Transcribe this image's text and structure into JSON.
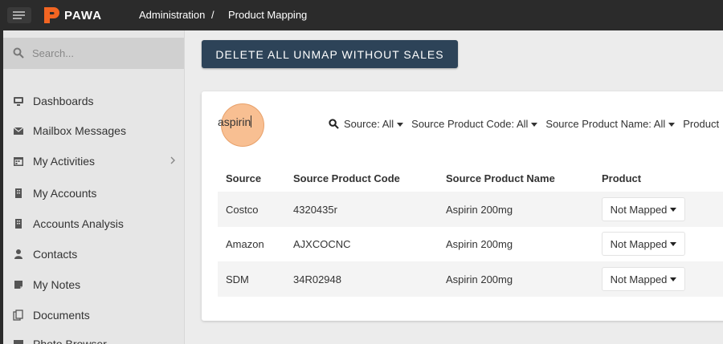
{
  "header": {
    "logo_text": "PAWA",
    "breadcrumb": [
      "Administration",
      "/",
      "Product Mapping"
    ],
    "brand_color": "#f26522"
  },
  "sidebar": {
    "search_placeholder": "Search...",
    "items": [
      {
        "label": "Dashboards",
        "icon": "monitor-icon"
      },
      {
        "label": "Mailbox Messages",
        "icon": "envelope-icon"
      },
      {
        "label": "My Activities",
        "icon": "calendar-icon",
        "has_submenu": true
      },
      {
        "label": "My Accounts",
        "icon": "building-icon"
      },
      {
        "label": "Accounts Analysis",
        "icon": "building-icon"
      },
      {
        "label": "Contacts",
        "icon": "user-icon"
      },
      {
        "label": "My Notes",
        "icon": "note-icon"
      },
      {
        "label": "Documents",
        "icon": "documents-icon"
      },
      {
        "label": "Photo Browser",
        "icon": "photo-icon"
      }
    ]
  },
  "main": {
    "delete_button": "DELETE ALL UNMAP WITHOUT SALES",
    "filter_value": "aspirin",
    "filters": [
      "Source: All",
      "Source Product Code: All",
      "Source Product Name: All",
      "Product"
    ],
    "table": {
      "columns": [
        "Source",
        "Source Product Code",
        "Source Product Name",
        "Product"
      ],
      "rows": [
        {
          "source": "Costco",
          "code": "4320435r",
          "name": "Aspirin 200mg",
          "product": "Not Mapped"
        },
        {
          "source": "Amazon",
          "code": "AJXCOCNC",
          "name": "Aspirin 200mg",
          "product": "Not Mapped"
        },
        {
          "source": "SDM",
          "code": "34R02948",
          "name": "Aspirin 200mg",
          "product": "Not Mapped"
        }
      ]
    }
  }
}
